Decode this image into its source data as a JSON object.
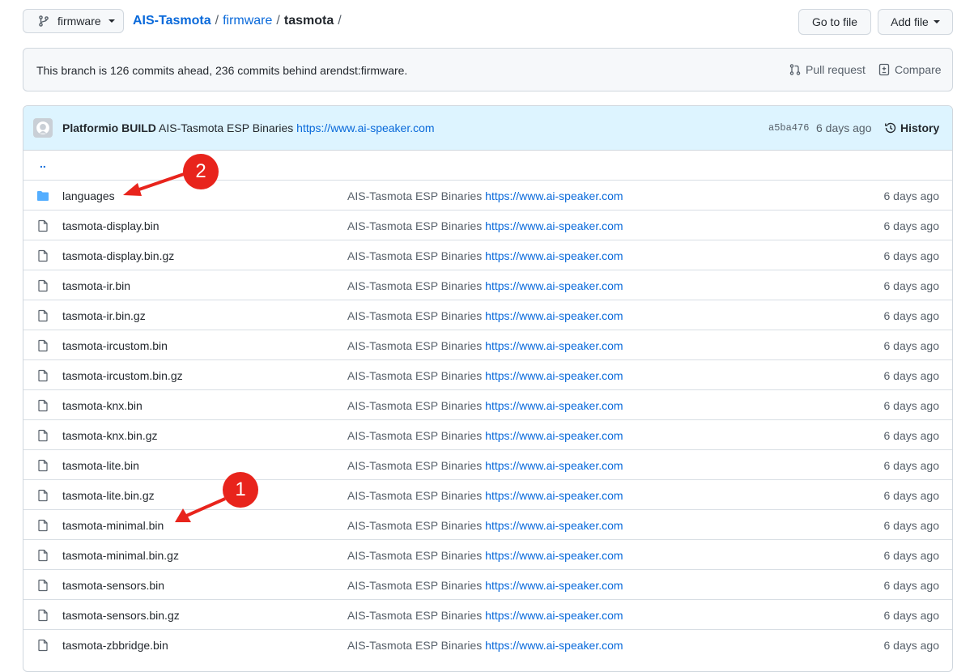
{
  "branch": {
    "label": "firmware"
  },
  "breadcrumb": {
    "owner": "AIS-Tasmota",
    "sep1": "/",
    "folder": "firmware",
    "sep2": "/",
    "current": "tasmota",
    "sep3": "/"
  },
  "toolbar": {
    "go_to_file": "Go to file",
    "add_file": "Add file"
  },
  "branch_status": {
    "message": "This branch is 126 commits ahead, 236 commits behind arendst:firmware.",
    "pull_request": "Pull request",
    "compare": "Compare"
  },
  "latest_commit": {
    "author": "Platformio BUILD",
    "message": "AIS-Tasmota ESP Binaries",
    "link": "https://www.ai-speaker.com",
    "sha": "a5ba476",
    "age": "6 days ago",
    "history": "History"
  },
  "parent_link": "..",
  "files": [
    {
      "name": "languages",
      "type": "dir",
      "msg": "AIS-Tasmota ESP Binaries",
      "link": "https://www.ai-speaker.com",
      "age": "6 days ago"
    },
    {
      "name": "tasmota-display.bin",
      "type": "file",
      "msg": "AIS-Tasmota ESP Binaries",
      "link": "https://www.ai-speaker.com",
      "age": "6 days ago"
    },
    {
      "name": "tasmota-display.bin.gz",
      "type": "file",
      "msg": "AIS-Tasmota ESP Binaries",
      "link": "https://www.ai-speaker.com",
      "age": "6 days ago"
    },
    {
      "name": "tasmota-ir.bin",
      "type": "file",
      "msg": "AIS-Tasmota ESP Binaries",
      "link": "https://www.ai-speaker.com",
      "age": "6 days ago"
    },
    {
      "name": "tasmota-ir.bin.gz",
      "type": "file",
      "msg": "AIS-Tasmota ESP Binaries",
      "link": "https://www.ai-speaker.com",
      "age": "6 days ago"
    },
    {
      "name": "tasmota-ircustom.bin",
      "type": "file",
      "msg": "AIS-Tasmota ESP Binaries",
      "link": "https://www.ai-speaker.com",
      "age": "6 days ago"
    },
    {
      "name": "tasmota-ircustom.bin.gz",
      "type": "file",
      "msg": "AIS-Tasmota ESP Binaries",
      "link": "https://www.ai-speaker.com",
      "age": "6 days ago"
    },
    {
      "name": "tasmota-knx.bin",
      "type": "file",
      "msg": "AIS-Tasmota ESP Binaries",
      "link": "https://www.ai-speaker.com",
      "age": "6 days ago"
    },
    {
      "name": "tasmota-knx.bin.gz",
      "type": "file",
      "msg": "AIS-Tasmota ESP Binaries",
      "link": "https://www.ai-speaker.com",
      "age": "6 days ago"
    },
    {
      "name": "tasmota-lite.bin",
      "type": "file",
      "msg": "AIS-Tasmota ESP Binaries",
      "link": "https://www.ai-speaker.com",
      "age": "6 days ago"
    },
    {
      "name": "tasmota-lite.bin.gz",
      "type": "file",
      "msg": "AIS-Tasmota ESP Binaries",
      "link": "https://www.ai-speaker.com",
      "age": "6 days ago"
    },
    {
      "name": "tasmota-minimal.bin",
      "type": "file",
      "msg": "AIS-Tasmota ESP Binaries",
      "link": "https://www.ai-speaker.com",
      "age": "6 days ago"
    },
    {
      "name": "tasmota-minimal.bin.gz",
      "type": "file",
      "msg": "AIS-Tasmota ESP Binaries",
      "link": "https://www.ai-speaker.com",
      "age": "6 days ago"
    },
    {
      "name": "tasmota-sensors.bin",
      "type": "file",
      "msg": "AIS-Tasmota ESP Binaries",
      "link": "https://www.ai-speaker.com",
      "age": "6 days ago"
    },
    {
      "name": "tasmota-sensors.bin.gz",
      "type": "file",
      "msg": "AIS-Tasmota ESP Binaries",
      "link": "https://www.ai-speaker.com",
      "age": "6 days ago"
    },
    {
      "name": "tasmota-zbbridge.bin",
      "type": "file",
      "msg": "AIS-Tasmota ESP Binaries",
      "link": "https://www.ai-speaker.com",
      "age": "6 days ago"
    }
  ],
  "annotations": [
    {
      "label": "2",
      "color": "#e8241c"
    },
    {
      "label": "1",
      "color": "#e8241c"
    }
  ],
  "icons": {
    "branch": "git-branch-icon",
    "pull": "pull-request-icon",
    "compare": "compare-icon",
    "history": "history-icon",
    "folder": "folder-icon",
    "file": "file-icon",
    "avatar": "github-avatar-icon"
  },
  "colors": {
    "link": "#0969da",
    "muted": "#57606a",
    "commit_bg": "#ddf4ff",
    "folder": "#54aeff",
    "annotation": "#e8241c"
  }
}
